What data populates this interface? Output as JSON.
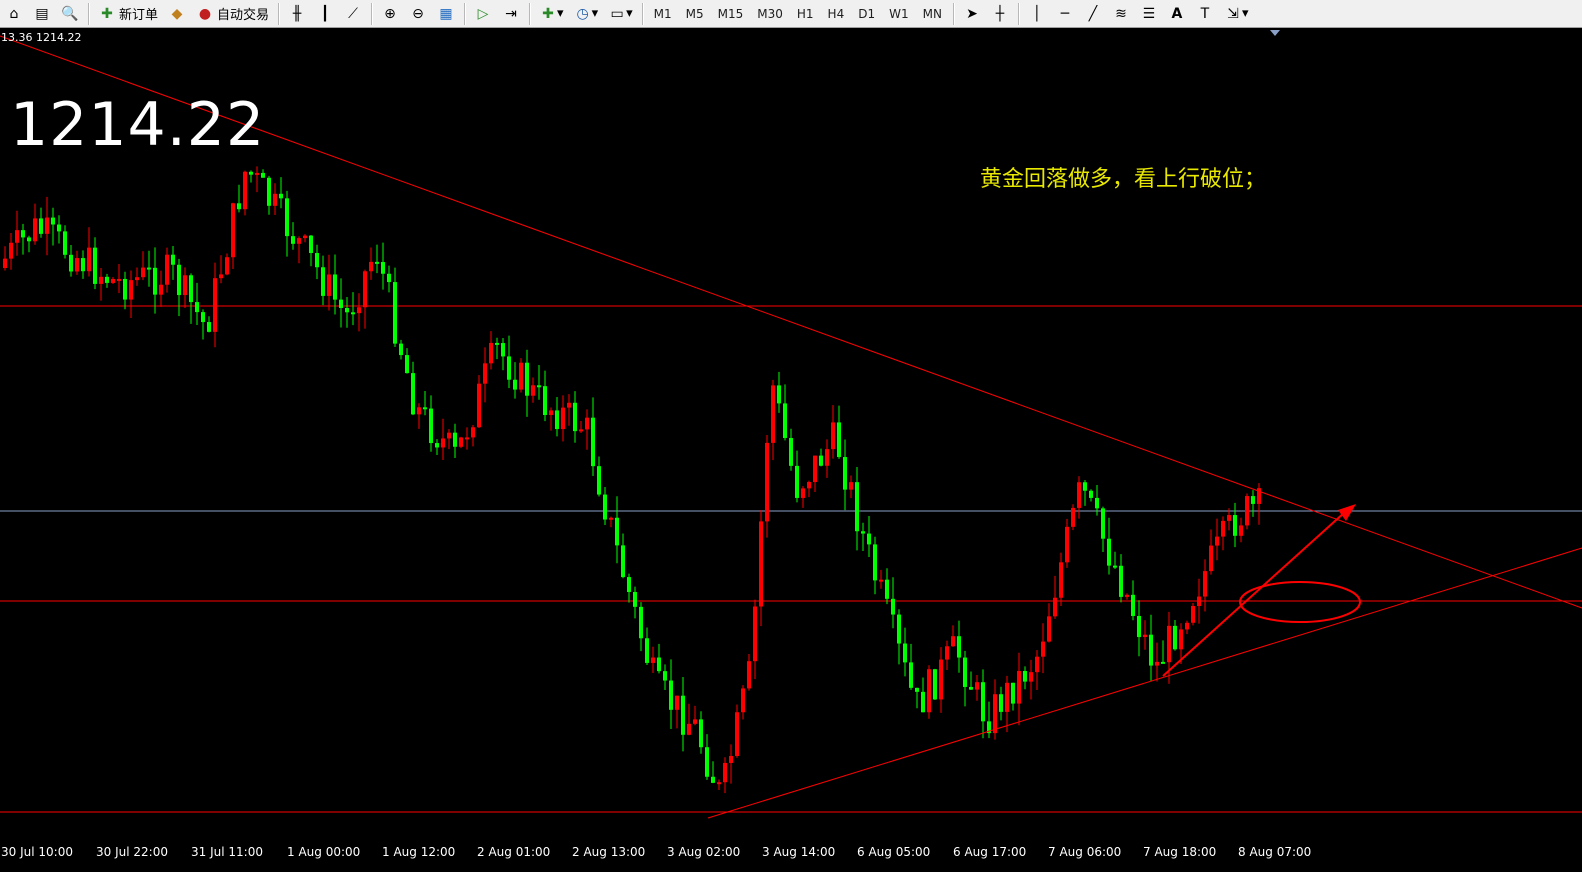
{
  "toolbar": {
    "new_order": "新订单",
    "auto_trading": "自动交易",
    "timeframes": [
      "M1",
      "M5",
      "M15",
      "M30",
      "H1",
      "H4",
      "D1",
      "W1",
      "MN"
    ],
    "icons": [
      "home-icon",
      "market-watch-icon",
      "navigator-icon",
      "new-order-icon",
      "expert-icon",
      "auto-trading-icon",
      "bar-chart-icon",
      "candlestick-icon",
      "line-chart-icon",
      "zoom-in-icon",
      "zoom-out-icon",
      "tile-windows-icon",
      "chart-shift-icon",
      "autoscroll-icon",
      "indicators-icon",
      "periods-icon",
      "templates-icon",
      "cursor-icon",
      "crosshair-icon",
      "vertical-line-icon",
      "horizontal-line-icon",
      "trendline-icon",
      "fibonacci-icon",
      "text-icon",
      "text-label-icon",
      "arrows-icon"
    ]
  },
  "chart": {
    "price_readout": "13.36 1214.22",
    "big_price": "1214.22",
    "annotation": "黄金回落做多，看上行破位；",
    "time_axis": [
      "30 Jul 10:00",
      "30 Jul 22:00",
      "31 Jul 11:00",
      "1 Aug 00:00",
      "1 Aug 12:00",
      "2 Aug 01:00",
      "2 Aug 13:00",
      "3 Aug 02:00",
      "3 Aug 14:00",
      "6 Aug 05:00",
      "6 Aug 17:00",
      "7 Aug 06:00",
      "7 Aug 18:00",
      "8 Aug 07:00"
    ],
    "colors": {
      "background": "#000000",
      "bull": "#ff0000",
      "bear": "#00ff00",
      "lines": "#ff0000",
      "bid_line": "#8aa0c8",
      "annotation": "#e8e800",
      "text": "#ffffff"
    }
  }
}
